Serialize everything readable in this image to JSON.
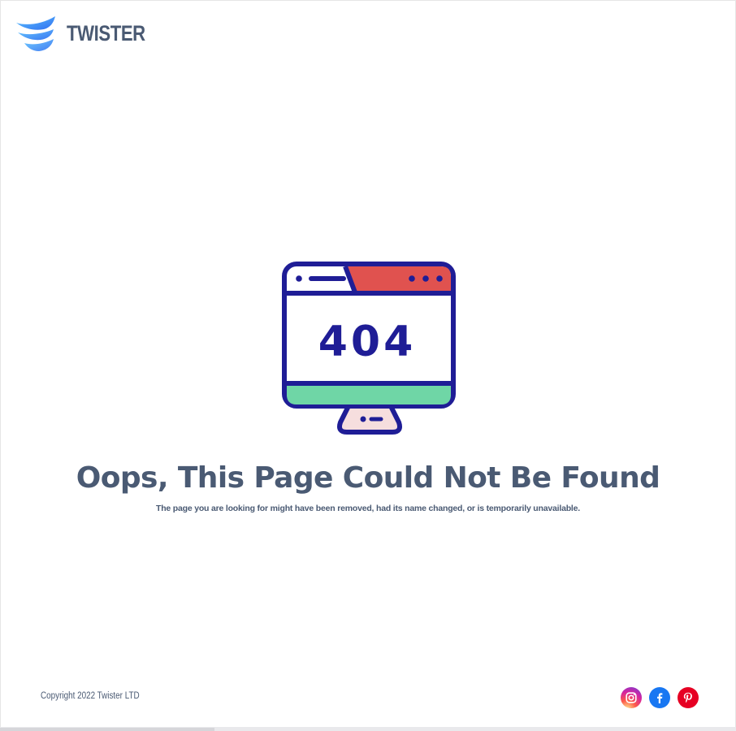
{
  "brand": {
    "name": "TWISTER",
    "logo_icon": "twister-swirl-icon",
    "text_color": "#4a5a73",
    "accent_gradient": [
      "#3a8dff",
      "#5ec6ff"
    ]
  },
  "illustration": {
    "icon": "monitor-404-icon",
    "code": "404",
    "colors": {
      "outline": "#1f1d96",
      "titlebar": "#e0524f",
      "base": "#6fd6a6",
      "stand": "#f6dede"
    }
  },
  "error": {
    "title": "Oops, This Page Could Not Be Found",
    "message": "The page you are looking for might have been removed, had its name changed, or is temporarily unavailable."
  },
  "footer": {
    "copyright": "Copyright 2022 Twister LTD",
    "social": [
      {
        "name": "instagram",
        "icon": "instagram-icon"
      },
      {
        "name": "facebook",
        "icon": "facebook-icon",
        "color": "#1877f2"
      },
      {
        "name": "pinterest",
        "icon": "pinterest-icon",
        "color": "#e60023"
      }
    ]
  }
}
